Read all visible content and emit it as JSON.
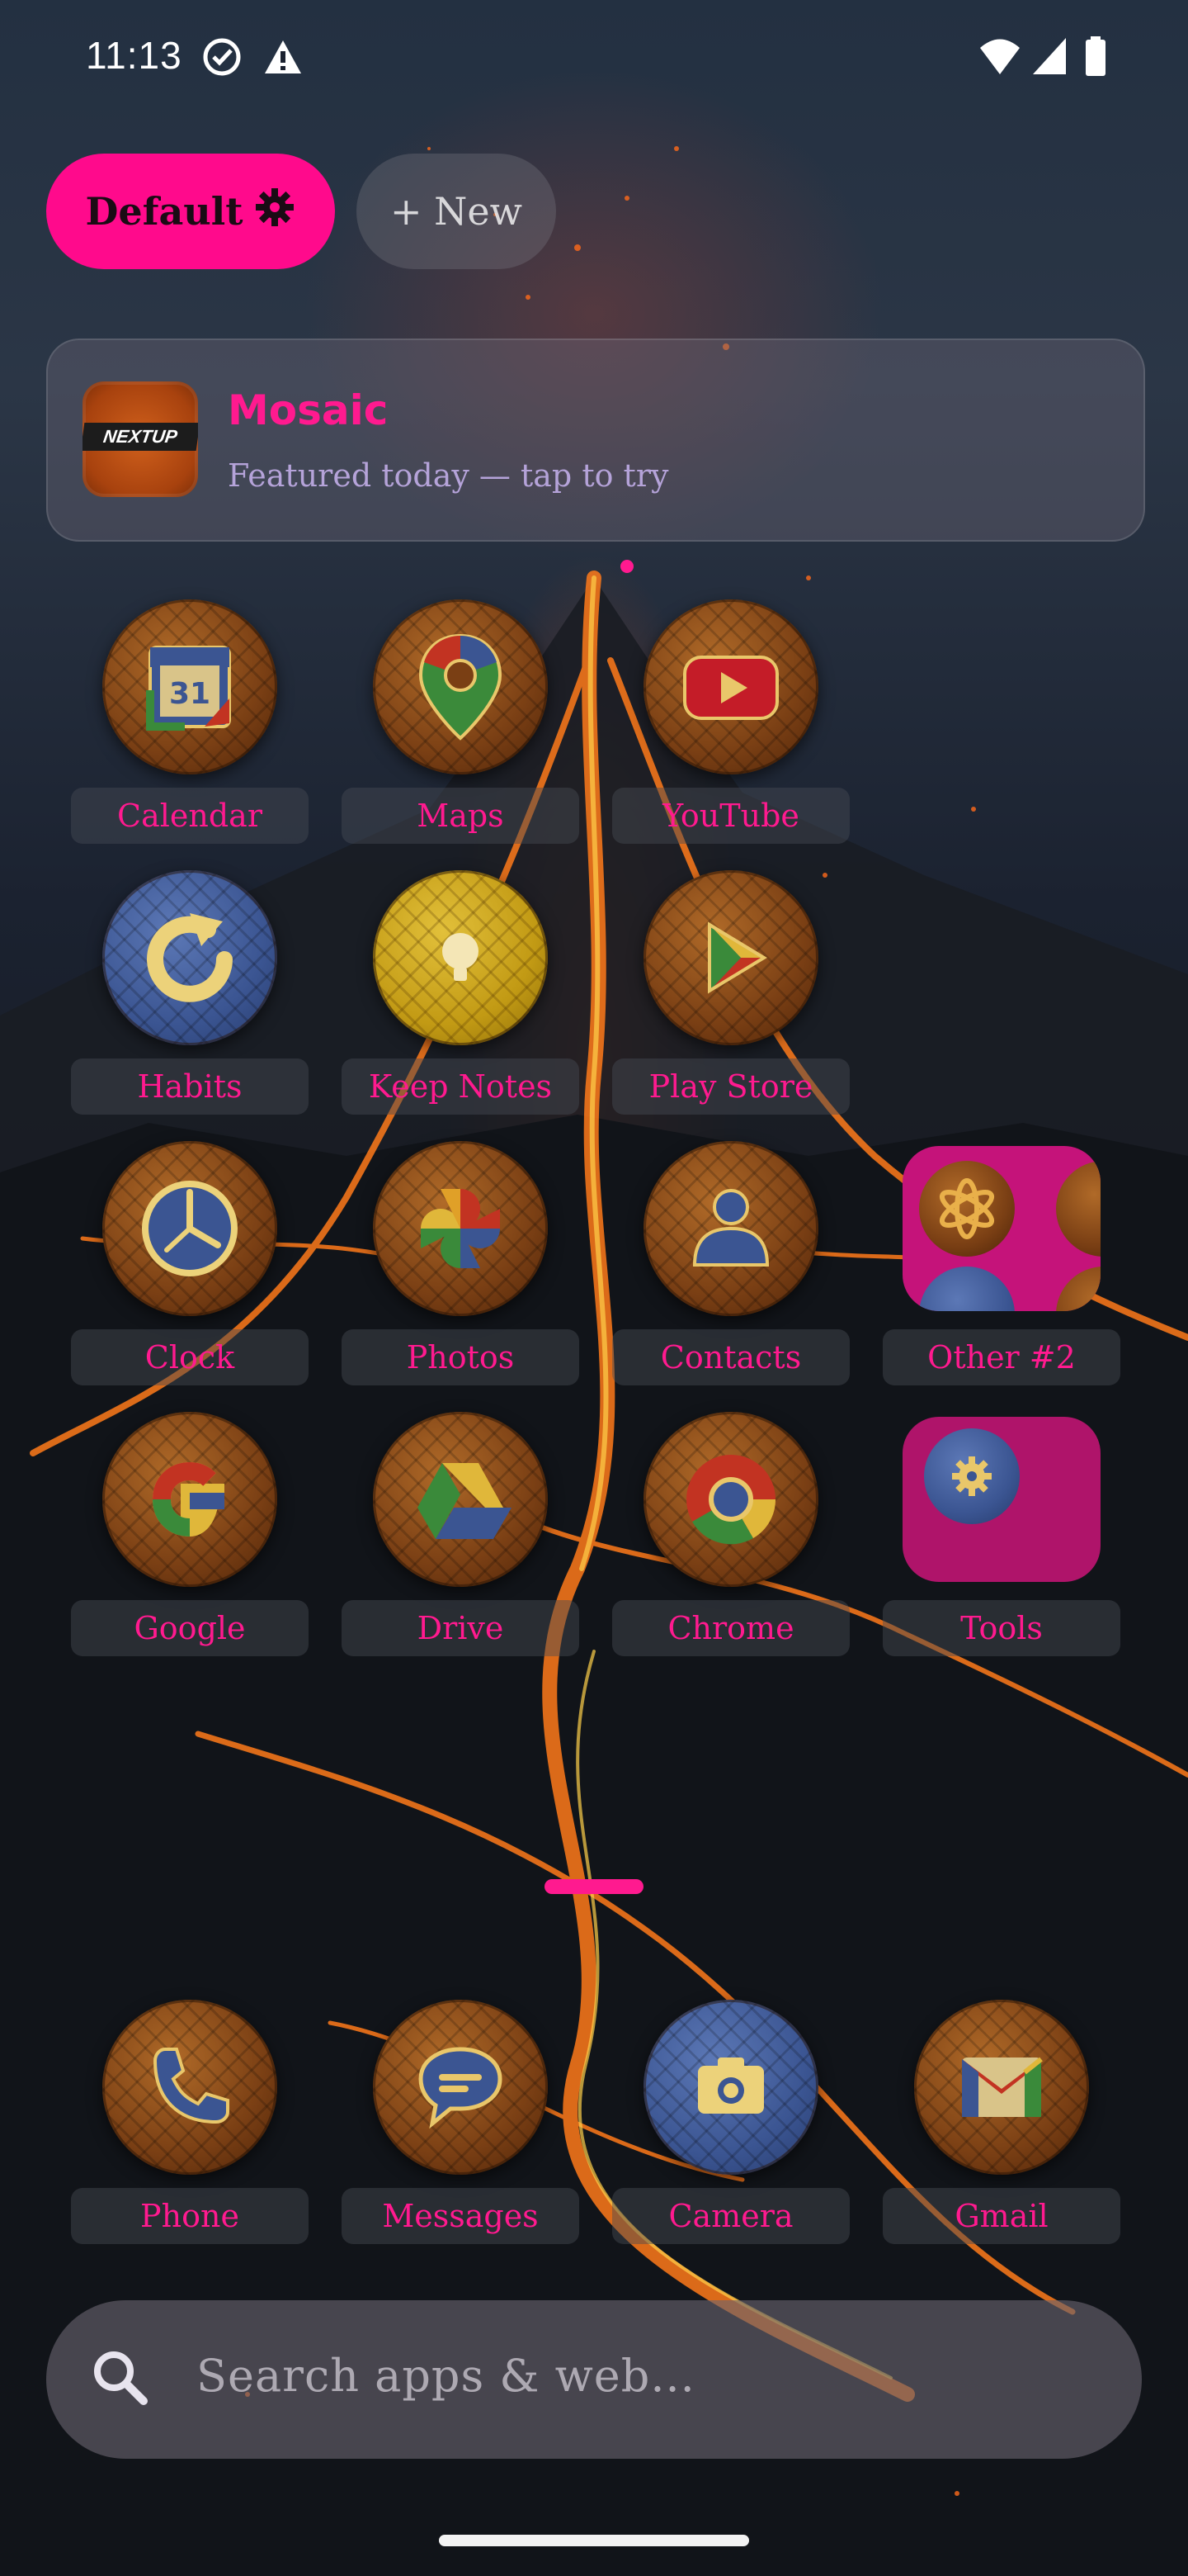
{
  "status_bar": {
    "time": "11:13",
    "icons": [
      "check-circle-icon",
      "warning-icon",
      "wifi-icon",
      "signal-icon",
      "battery-icon"
    ]
  },
  "profiles": {
    "default_label": "Default",
    "new_label": "+ New"
  },
  "featured": {
    "thumb_text": "NEXTUP",
    "title": "Mosaic",
    "subtitle": "Featured today — tap to try"
  },
  "grid": {
    "rows": [
      [
        {
          "label": "Calendar",
          "icon": "calendar-icon"
        },
        {
          "label": "Maps",
          "icon": "maps-pin-icon"
        },
        {
          "label": "YouTube",
          "icon": "youtube-icon"
        }
      ],
      [
        {
          "label": "Habits",
          "icon": "refresh-icon"
        },
        {
          "label": "Keep Notes",
          "icon": "lightbulb-icon"
        },
        {
          "label": "Play Store",
          "icon": "play-store-icon"
        }
      ],
      [
        {
          "label": "Clock",
          "icon": "clock-icon"
        },
        {
          "label": "Photos",
          "icon": "pinwheel-icon"
        },
        {
          "label": "Contacts",
          "icon": "person-icon"
        },
        {
          "label": "Other #2",
          "icon": "folder-icon"
        }
      ],
      [
        {
          "label": "Google",
          "icon": "google-g-icon"
        },
        {
          "label": "Drive",
          "icon": "drive-icon"
        },
        {
          "label": "Chrome",
          "icon": "chrome-icon"
        },
        {
          "label": "Tools",
          "icon": "folder-icon"
        }
      ]
    ]
  },
  "dock": [
    {
      "label": "Phone",
      "icon": "phone-icon"
    },
    {
      "label": "Messages",
      "icon": "messages-icon"
    },
    {
      "label": "Camera",
      "icon": "camera-icon"
    },
    {
      "label": "Gmail",
      "icon": "gmail-icon"
    }
  ],
  "search": {
    "placeholder": "Search apps & web..."
  },
  "colors": {
    "accent": "#ff1a8f",
    "chip_active": "#ff0a8c",
    "label_bg": "#464b55"
  }
}
